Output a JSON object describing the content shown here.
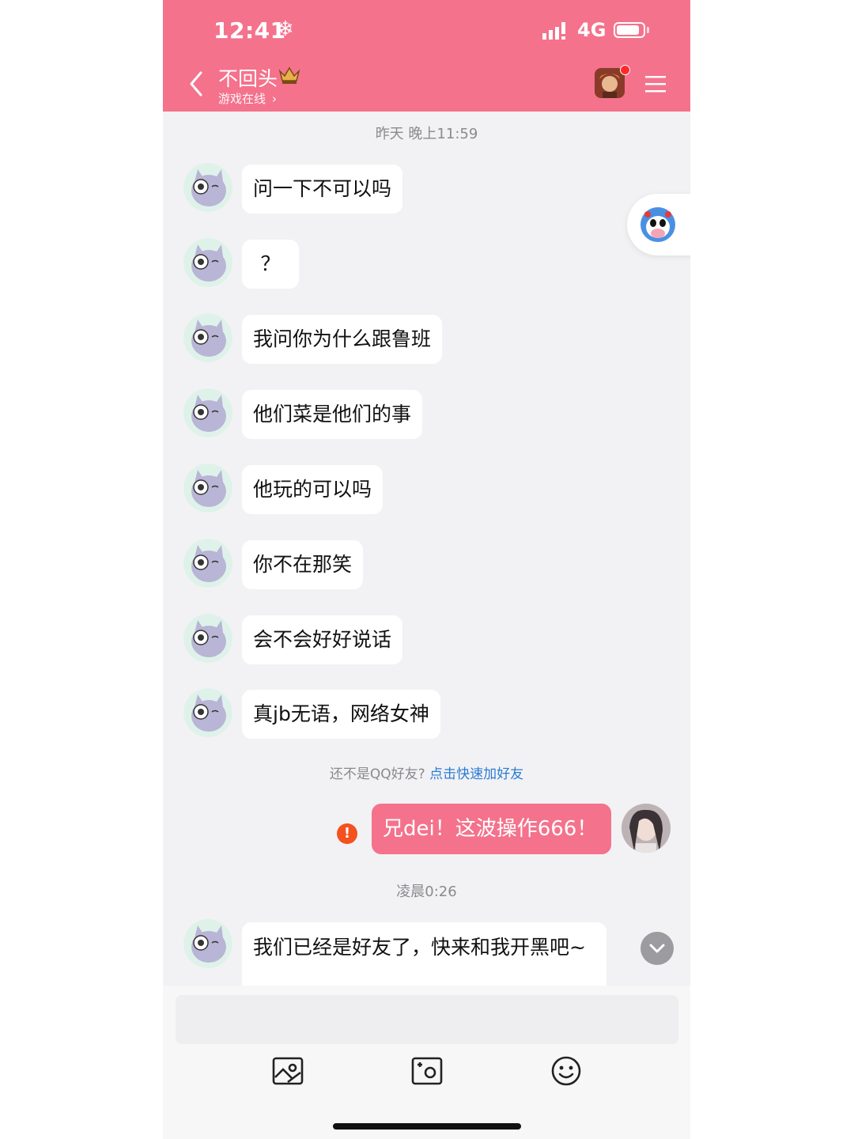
{
  "status_bar": {
    "time": "12:41",
    "snow_icon": "❄",
    "network": "4G"
  },
  "header": {
    "contact_name": "不回头",
    "status": "游戏在线",
    "chevron": "›"
  },
  "chat": {
    "time_top": "昨天 晚上11:59",
    "messages": [
      "问一下不可以吗",
      "？",
      "我问你为什么跟鲁班",
      "他们菜是他们的事",
      "他玩的可以吗",
      "你不在那笑",
      "会不会好好说话",
      "真jb无语，网络女神"
    ],
    "add_hint_prefix": "还不是QQ好友?",
    "add_hint_link": "点击快速加好友",
    "my_message": "兄dei！这波操作666！",
    "fail_mark": "!",
    "time_bottom": "凌晨0:26",
    "last_message": "我们已经是好友了，快来和我开黑吧~"
  },
  "colors": {
    "accent": "#f4728c",
    "link": "#2b7cd3",
    "error": "#f4511e",
    "background": "#f2f2f4"
  },
  "icons": [
    "back-icon",
    "crown-icon",
    "menu-icon",
    "image-icon",
    "camera-icon",
    "emoji-icon",
    "chevron-down-icon",
    "alert-icon"
  ]
}
